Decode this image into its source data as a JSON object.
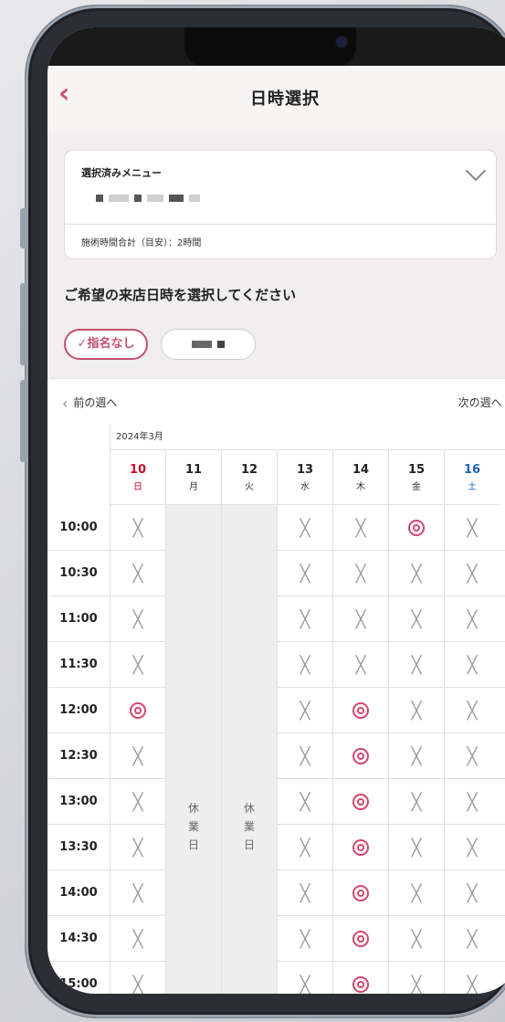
{
  "app": {
    "back_icon": "‹",
    "title": "日時選択"
  },
  "menu": {
    "label": "選択済みメニュー",
    "time_label": "施術時間合計（目安）：2時間"
  },
  "prompt": "ご希望の来店日時を選択してください",
  "staff": {
    "chip_none": "✓指名なし"
  },
  "week_nav": {
    "prev_label": "前の週へ",
    "next_label": "次の週へ",
    "prev_icon": "‹",
    "next_icon": "›"
  },
  "calendar": {
    "month": "2024年3月",
    "days": [
      {
        "num": "10",
        "dow": "日",
        "type": "sun"
      },
      {
        "num": "11",
        "dow": "月",
        "type": ""
      },
      {
        "num": "12",
        "dow": "火",
        "type": ""
      },
      {
        "num": "13",
        "dow": "水",
        "type": ""
      },
      {
        "num": "14",
        "dow": "木",
        "type": ""
      },
      {
        "num": "15",
        "dow": "金",
        "type": ""
      },
      {
        "num": "16",
        "dow": "土",
        "type": "sat"
      }
    ],
    "closed_label": "休\n業\n日",
    "closed_days": [
      1,
      2
    ],
    "symbols": {
      "available": "◎",
      "unavailable": "×"
    },
    "slots": [
      {
        "time": "10:00",
        "status": [
          "×",
          "",
          "",
          "×",
          "×",
          "◎",
          "×"
        ]
      },
      {
        "time": "10:30",
        "status": [
          "×",
          "",
          "",
          "×",
          "×",
          "×",
          "×"
        ]
      },
      {
        "time": "11:00",
        "status": [
          "×",
          "",
          "",
          "×",
          "×",
          "×",
          "×"
        ]
      },
      {
        "time": "11:30",
        "status": [
          "×",
          "",
          "",
          "×",
          "×",
          "×",
          "×"
        ]
      },
      {
        "time": "12:00",
        "status": [
          "◎",
          "",
          "",
          "×",
          "◎",
          "×",
          "×"
        ]
      },
      {
        "time": "12:30",
        "status": [
          "×",
          "",
          "",
          "×",
          "◎",
          "×",
          "×"
        ]
      },
      {
        "time": "13:00",
        "status": [
          "×",
          "",
          "",
          "×",
          "◎",
          "×",
          "×"
        ]
      },
      {
        "time": "13:30",
        "status": [
          "×",
          "",
          "",
          "×",
          "◎",
          "×",
          "×"
        ]
      },
      {
        "time": "14:00",
        "status": [
          "×",
          "",
          "",
          "×",
          "◎",
          "×",
          "×"
        ]
      },
      {
        "time": "14:30",
        "status": [
          "×",
          "",
          "",
          "×",
          "◎",
          "×",
          "×"
        ]
      },
      {
        "time": "15:00",
        "status": [
          "×",
          "",
          "",
          "×",
          "◎",
          "×",
          "×"
        ]
      }
    ]
  },
  "colors": {
    "accent": "#c4506e",
    "sunday": "#c0102b",
    "saturday": "#1e64b4"
  }
}
